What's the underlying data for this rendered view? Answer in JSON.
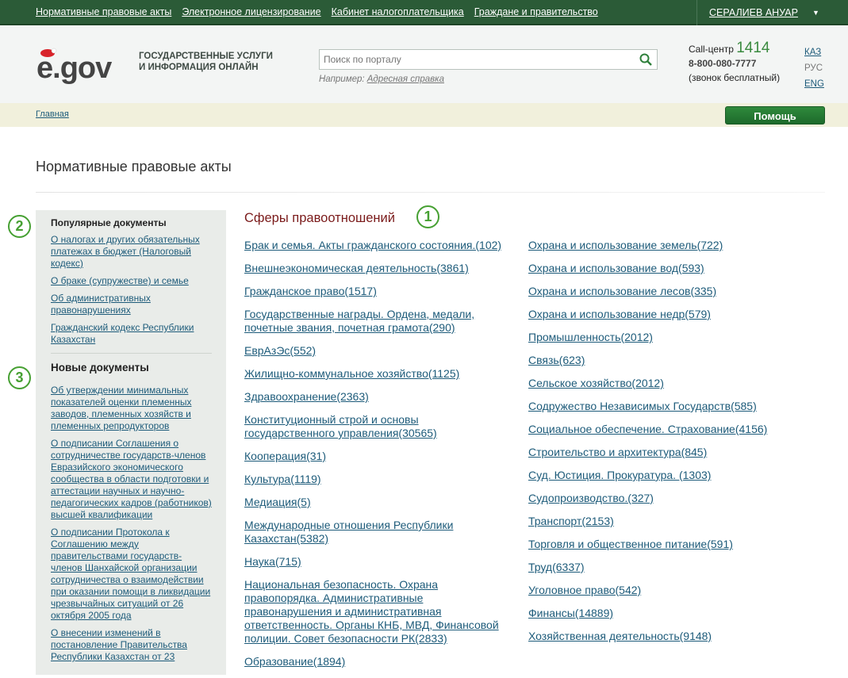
{
  "topbar": {
    "links": [
      "Нормативные правовые акты",
      "Электронное лицензирование",
      "Кабинет налогоплательщика",
      "Граждане и правительство"
    ],
    "user": "СЕРАЛИЕВ АНУАР"
  },
  "header": {
    "logo_text": "e.gov",
    "tagline_line1": "ГОСУДАРСТВЕННЫЕ УСЛУГИ",
    "tagline_line2": "И ИНФОРМАЦИЯ ОНЛАЙН",
    "search_placeholder": "Поиск по порталу",
    "example_label": "Например:",
    "example_link": "Адресная справка",
    "callcenter_label": "Call-центр",
    "callcenter_number": "1414",
    "phone": "8-800-080-7777",
    "phone_note": "(звонок бесплатный)",
    "langs": [
      "КАЗ",
      "РУС",
      "ENG"
    ]
  },
  "breadcrumb": "Главная",
  "help_label": "Помощь",
  "page_title": "Нормативные правовые акты",
  "badges": [
    "1",
    "2",
    "3"
  ],
  "sidebar": {
    "popular_title": "Популярные документы",
    "popular": [
      "О налогах и других обязательных платежах в бюджет (Налоговый кодекс)",
      "О браке (супружестве) и семье",
      "Об административных правонарушениях",
      "Гражданский кодекс Республики Казахстан"
    ],
    "new_title": "Новые документы",
    "new": [
      "Об утверждении минимальных показателей оценки племенных заводов, племенных хозяйств и племенных репродукторов",
      "О подписании Соглашения о сотрудничестве государств-членов Евразийского экономического сообщества в области подготовки и аттестации научных и научно-педагогических кадров (работников) высшей квалификации",
      "О подписании Протокола к Соглашению между правительствами государств-членов Шанхайской организации сотрудничества о взаимодействии при оказании помощи в ликвидации чрезвычайных ситуаций от 26 октября 2005 года",
      "О внесении изменений в постановление Правительства Республики Казахстан от 23"
    ]
  },
  "main": {
    "title": "Сферы правоотношений",
    "col1": [
      "Брак и семья. Акты гражданского состояния.(102)",
      "Внешнеэкономическая деятельность(3861)",
      "Гражданское право(1517)",
      "Государственные награды. Ордена, медали, почетные звания, почетная грамота(290)",
      "ЕврАзЭс(552)",
      "Жилищно-коммунальное хозяйство(1125)",
      "Здравоохранение(2363)",
      "Конституционный строй и основы государственного управления(30565)",
      "Кооперация(31)",
      "Культура(1119)",
      "Медиация(5)",
      "Международные отношения Республики Казахстан(5382)",
      "Наука(715)",
      "Национальная безопасность. Охрана правопорядка. Административные правонарушения и административная ответственность. Органы КНБ, МВД, Финансовой полиции. Совет безопасности РК(2833)",
      "Образование(1894)"
    ],
    "col2": [
      "Охрана и использование земель(722)",
      "Охрана и использование вод(593)",
      "Охрана и использование лесов(335)",
      "Охрана и использование недр(579)",
      "Промышленность(2012)",
      "Связь(623)",
      "Сельское хозяйство(2012)",
      "Содружество Независимых Государств(585)",
      "Социальное обеспечение. Страхование(4156)",
      "Строительство и архитектура(845)",
      "Суд. Юстиция. Прокуратура. (1303)",
      "Судопроизводство.(327)",
      "Транспорт(2153)",
      "Торговля и общественное питание(591)",
      "Труд(6337)",
      "Уголовное право(542)",
      "Финансы(14889)",
      "Хозяйственная деятельность(9148)"
    ]
  }
}
